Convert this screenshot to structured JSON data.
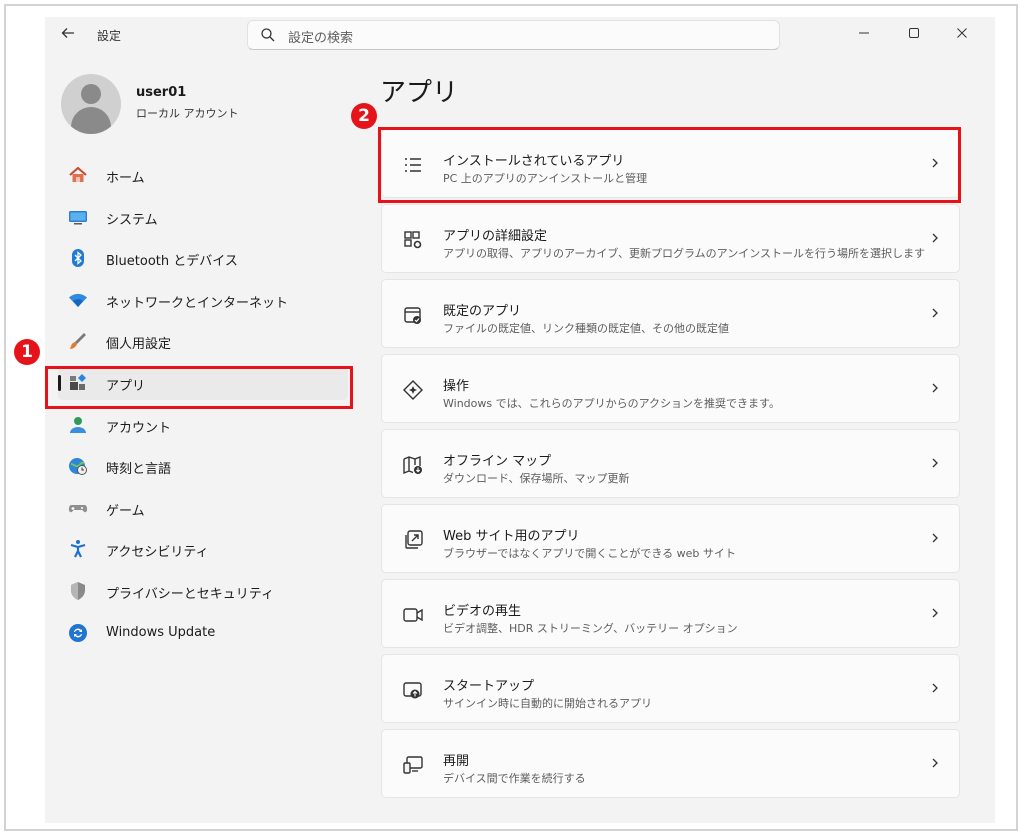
{
  "window": {
    "title": "設定",
    "back_icon": "arrow-left-icon",
    "search_placeholder": "設定の検索"
  },
  "profile": {
    "username": "user01",
    "account_type": "ローカル アカウント"
  },
  "nav": {
    "items": [
      {
        "label": "ホーム",
        "icon": "home-icon"
      },
      {
        "label": "システム",
        "icon": "monitor-icon"
      },
      {
        "label": "Bluetooth とデバイス",
        "icon": "bluetooth-icon"
      },
      {
        "label": "ネットワークとインターネット",
        "icon": "wifi-icon"
      },
      {
        "label": "個人用設定",
        "icon": "brush-icon"
      },
      {
        "label": "アプリ",
        "icon": "apps-icon",
        "active": true
      },
      {
        "label": "アカウント",
        "icon": "person-icon"
      },
      {
        "label": "時刻と言語",
        "icon": "globe-clock-icon"
      },
      {
        "label": "ゲーム",
        "icon": "gamepad-icon"
      },
      {
        "label": "アクセシビリティ",
        "icon": "accessibility-icon"
      },
      {
        "label": "プライバシーとセキュリティ",
        "icon": "shield-icon"
      },
      {
        "label": "Windows Update",
        "icon": "update-icon"
      }
    ]
  },
  "main": {
    "title": "アプリ",
    "cards": [
      {
        "title": "インストールされているアプリ",
        "desc": "PC 上のアプリのアンインストールと管理",
        "icon": "list-icon"
      },
      {
        "title": "アプリの詳細設定",
        "desc": "アプリの取得、アプリのアーカイブ、更新プログラムのアンインストールを行う場所を選択します",
        "icon": "app-settings-icon"
      },
      {
        "title": "既定のアプリ",
        "desc": "ファイルの既定値、リンク種類の既定値、その他の既定値",
        "icon": "default-apps-icon"
      },
      {
        "title": "操作",
        "desc": "Windows では、これらのアプリからのアクションを推奨できます。",
        "icon": "actions-icon"
      },
      {
        "title": "オフライン マップ",
        "desc": "ダウンロード、保存場所、マップ更新",
        "icon": "map-icon"
      },
      {
        "title": "Web サイト用のアプリ",
        "desc": "ブラウザーではなくアプリで開くことができる web サイト",
        "icon": "open-external-icon"
      },
      {
        "title": "ビデオの再生",
        "desc": "ビデオ調整、HDR ストリーミング、バッテリー オプション",
        "icon": "video-icon"
      },
      {
        "title": "スタートアップ",
        "desc": "サインイン時に自動的に開始されるアプリ",
        "icon": "startup-icon"
      },
      {
        "title": "再開",
        "desc": "デバイス間で作業を続行する",
        "icon": "resume-icon"
      }
    ]
  },
  "annotations": {
    "step1": "1",
    "step2": "2",
    "color": "#e5141b"
  }
}
